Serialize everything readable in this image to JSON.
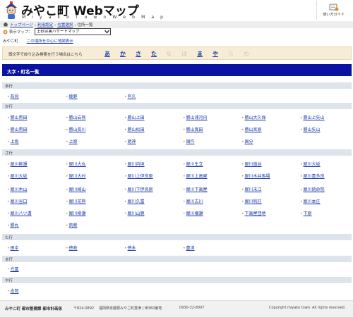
{
  "header": {
    "title": "みやこ町 Webマップ",
    "subtitle": "M i y a k o   T o w n   W e b   M a p",
    "guide_label": "使い方ガイド"
  },
  "breadcrumb": [
    "トップページ",
    "利用認定",
    "位置選択"
  ],
  "breadcrumb_current": "住所一覧",
  "map_select": {
    "label": "表示マップ：",
    "value": "土砂災害ハザードマップ"
  },
  "location": {
    "place": "みやこ町",
    "link": "この場所を中心に地図表示"
  },
  "kana_filter": {
    "hint": "頭文字で絞り込み検索を行う場合はこちら",
    "items": [
      {
        "label": "あ",
        "enabled": true
      },
      {
        "label": "か",
        "enabled": true
      },
      {
        "label": "さ",
        "enabled": true
      },
      {
        "label": "た",
        "enabled": true
      },
      {
        "label": "な",
        "enabled": false
      },
      {
        "label": "は",
        "enabled": false
      },
      {
        "label": "ま",
        "enabled": true
      },
      {
        "label": "や",
        "enabled": true
      },
      {
        "label": "ら",
        "enabled": false
      },
      {
        "label": "わ",
        "enabled": false
      }
    ]
  },
  "list_title": "大字・町名一覧",
  "sections": [
    {
      "head": "あ行",
      "rows": [
        [
          "呰見",
          "綾野",
          "有久"
        ]
      ]
    },
    {
      "head": "か行",
      "rows": [
        [
          "勝山黒田",
          "勝山岩熊",
          "勝山上田",
          "勝山浦河内",
          "勝山大久保",
          "勝山上矢山"
        ],
        [
          "勝山黒田",
          "勝山長川",
          "勝山松田",
          "勝山箕田",
          "勝山宮原",
          "勝山矢山"
        ],
        [
          "上坂",
          "上原",
          "姥神",
          "国作",
          "国分"
        ]
      ]
    },
    {
      "head": "さ行",
      "rows": [
        [
          "犀川柳瀬",
          "犀川大丸",
          "犀川内垣",
          "犀川生立",
          "犀川扇谷",
          "犀川大坂"
        ],
        [
          "犀川大坂",
          "犀川大村",
          "犀川上伊良原",
          "犀川上高屋",
          "犀川木井馬場",
          "犀川喜多良"
        ],
        [
          "犀川木山",
          "犀川崎山",
          "犀川下伊良原",
          "犀川下高屋",
          "犀川末江",
          "犀川続命院"
        ],
        [
          "犀川谷口",
          "犀川花熊",
          "犀川久富",
          "犀川古川",
          "犀川帆柱",
          "犀川本庄"
        ],
        [
          "犀川八ツ溝",
          "犀川柳瀬",
          "犀川山鹿",
          "犀川横瀬",
          "下高屋団地",
          "下原"
        ],
        [
          "勝丸",
          "筑紫"
        ]
      ]
    },
    {
      "head": "た行",
      "rows": [
        [
          "田中",
          "徳政",
          "徳永",
          "豊津"
        ]
      ]
    },
    {
      "head": "ま行",
      "rows": [
        [
          "光冨"
        ]
      ]
    },
    {
      "head": "や行",
      "rows": [
        [
          "吉岡"
        ]
      ]
    }
  ],
  "footer": {
    "org": "みやこ町 都市整備課 都市計画係",
    "zip": "〒824-0892",
    "address": "福岡県京都郡みやこ町豊津 | 田360番地",
    "tel": "0930-32-8007",
    "copyright": "Copyright miyako town. All rights reserved."
  },
  "colors": {
    "title_bar": "#0a14a0",
    "link": "#1a3aa8",
    "section_head": "#dde4ec",
    "kana_bg": "#f7ecd6",
    "bullet": "#e08a2a"
  }
}
